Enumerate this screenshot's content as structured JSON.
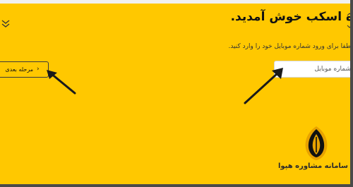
{
  "page": {
    "title": "ه اسکب خوش آمدید.",
    "subtitle": "لطفا برای ورود شماره موبایل خود را وارد کنید."
  },
  "form": {
    "mobile_placeholder": "شماره موبایل",
    "next_button_label": "مرحله بعدی"
  },
  "logo": {
    "text": "سامانه مشاوره هپوا"
  },
  "colors": {
    "background": "#ffc800",
    "input_background": "#ffffff",
    "arrow": "#1a1a1a",
    "logo_outer": "#e8a200",
    "logo_inner": "#111111"
  },
  "icons": {
    "next_button_icon": "chevron-left-icon",
    "collapse_icon": "double-chevron-down-icon",
    "logo_icon": "pen-nib-icon"
  }
}
